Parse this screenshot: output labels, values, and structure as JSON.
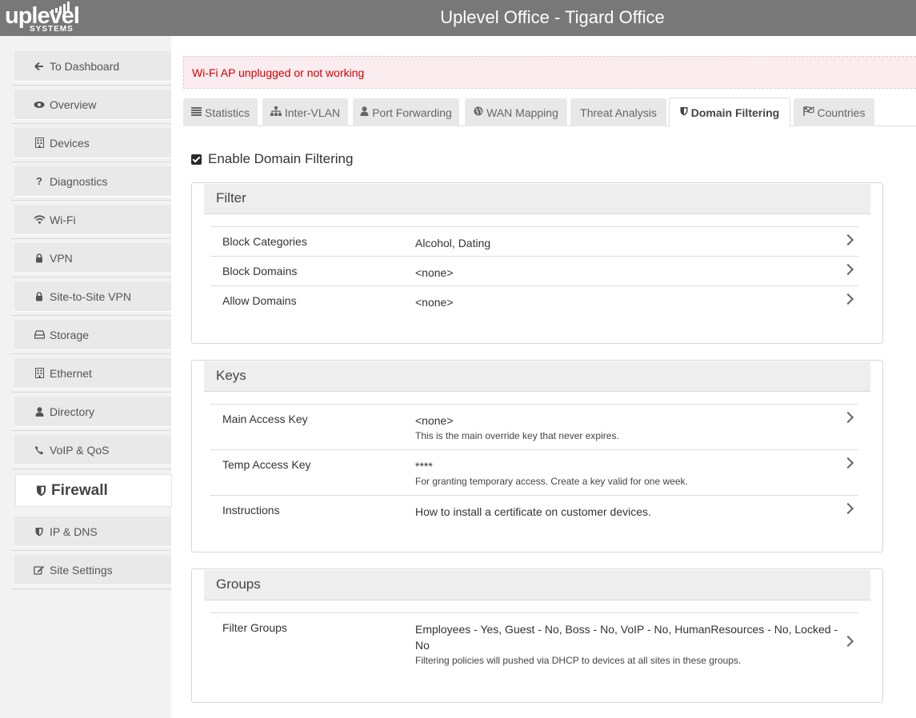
{
  "header": {
    "logo_text": "uplevel",
    "logo_sub": "SYSTEMS",
    "title": "Uplevel Office - Tigard Office"
  },
  "sidebar": {
    "items": [
      {
        "label": "To Dashboard",
        "icon": "arrow-left-icon"
      },
      {
        "label": "Overview",
        "icon": "eye-icon"
      },
      {
        "label": "Devices",
        "icon": "building-icon"
      },
      {
        "label": "Diagnostics",
        "icon": "question-icon"
      },
      {
        "label": "Wi-Fi",
        "icon": "wifi-icon"
      },
      {
        "label": "VPN",
        "icon": "lock-icon"
      },
      {
        "label": "Site-to-Site VPN",
        "icon": "lock-icon"
      },
      {
        "label": "Storage",
        "icon": "hdd-icon"
      },
      {
        "label": "Ethernet",
        "icon": "building-icon"
      },
      {
        "label": "Directory",
        "icon": "user-icon"
      },
      {
        "label": "VoIP & QoS",
        "icon": "phone-icon"
      },
      {
        "label": "Firewall",
        "icon": "shield-icon"
      },
      {
        "label": "IP & DNS",
        "icon": "shield-icon"
      },
      {
        "label": "Site Settings",
        "icon": "edit-icon"
      }
    ],
    "active_index": 11
  },
  "alert": {
    "text": "Wi-Fi AP unplugged or not working",
    "color": "#d40000"
  },
  "tabs": [
    {
      "label": "Statistics",
      "icon": "list-icon"
    },
    {
      "label": "Inter-VLAN",
      "icon": "sitemap-icon"
    },
    {
      "label": "Port Forwarding",
      "icon": "user-icon"
    },
    {
      "label": "WAN Mapping",
      "icon": "globe-icon"
    },
    {
      "label": "Threat Analysis",
      "icon": ""
    },
    {
      "label": "Domain Filtering",
      "icon": "shield-icon"
    },
    {
      "label": "Countries",
      "icon": "flag-icon"
    }
  ],
  "enable": {
    "label": "Enable Domain Filtering",
    "checked": true
  },
  "filter": {
    "title": "Filter",
    "rows": [
      {
        "label": "Block Categories",
        "value": "Alcohol, Dating"
      },
      {
        "label": "Block Domains",
        "value": "<none>"
      },
      {
        "label": "Allow Domains",
        "value": "<none>"
      }
    ]
  },
  "keys": {
    "title": "Keys",
    "rows": [
      {
        "label": "Main Access Key",
        "value": "<none>",
        "note": "This is the main override key that never expires."
      },
      {
        "label": "Temp Access Key",
        "value": "****",
        "note": "For granting temporary access. Create a key valid for one week."
      },
      {
        "label": "Instructions",
        "value": "How to install a certificate on customer devices."
      }
    ]
  },
  "groups": {
    "title": "Groups",
    "rows": [
      {
        "label": "Filter Groups",
        "value": "Employees - Yes, Guest - No, Boss - No, VoIP - No, HumanResources - No, Locked - No",
        "note": "Filtering policies will pushed via DHCP to devices at all sites in these groups."
      }
    ]
  }
}
